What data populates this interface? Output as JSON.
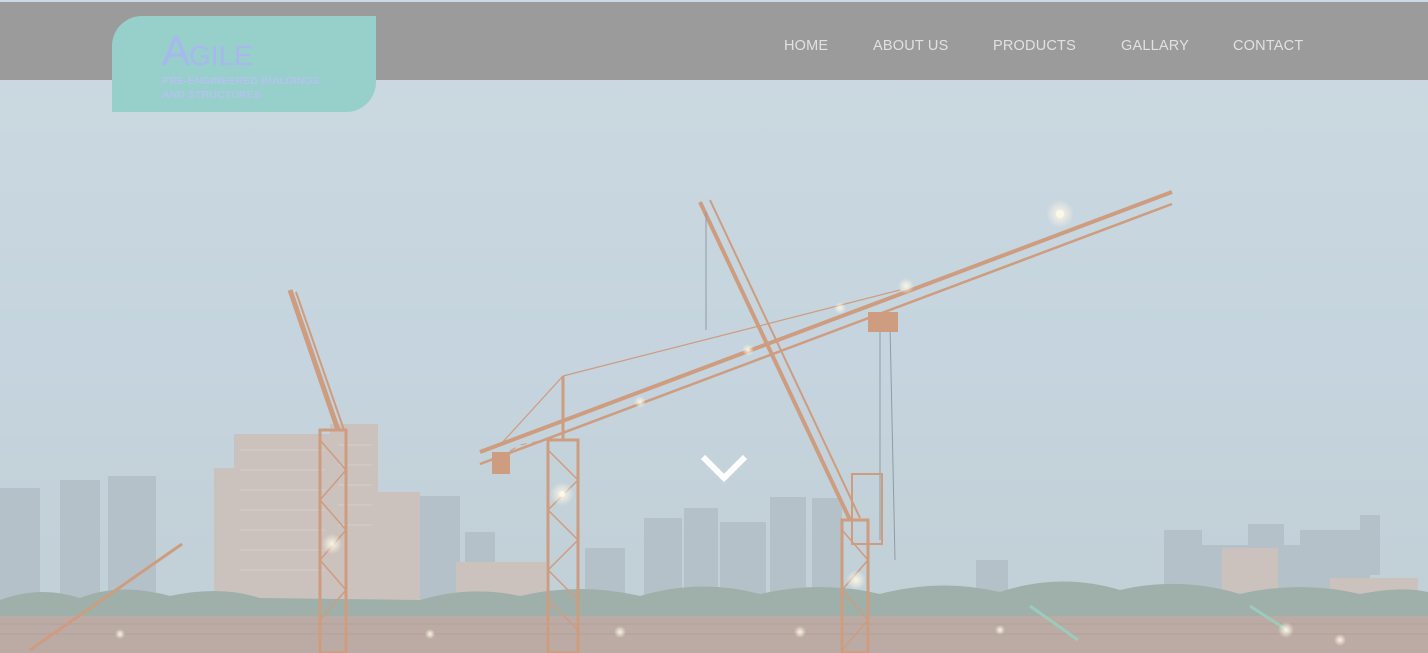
{
  "logo": {
    "initial": "A",
    "rest": "GILE",
    "tagline_line1": "PRE-ENGINEERED BUILDINGS",
    "tagline_line2": "AND STRUCTURES"
  },
  "nav": {
    "items": [
      {
        "label": "HOME"
      },
      {
        "label": "ABOUT US"
      },
      {
        "label": "PRODUCTS"
      },
      {
        "label": "GALLARY"
      },
      {
        "label": "CONTACT"
      }
    ]
  },
  "hero": {
    "scroll_icon": "chevron-down-icon"
  },
  "colors": {
    "header_bg": "#9b9b9b",
    "logo_bg": "#97cfcb",
    "logo_text": "#a9b6f0",
    "nav_text": "#e1e1e1",
    "crane": "#c98a66",
    "sky": "#bfcdd7"
  }
}
